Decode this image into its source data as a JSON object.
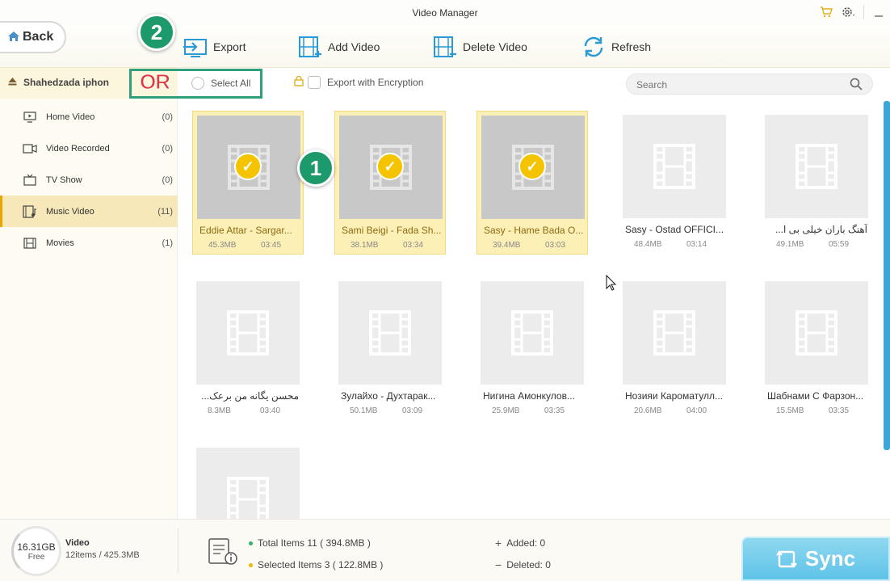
{
  "window": {
    "title": "Video Manager"
  },
  "toolbar": {
    "back_label": "Back",
    "export_label": "Export",
    "add_label": "Add Video",
    "delete_label": "Delete Video",
    "refresh_label": "Refresh"
  },
  "annotations": {
    "step1": "1",
    "step2": "2",
    "or": "OR"
  },
  "device": {
    "name": "Shahedzada iphon"
  },
  "selection": {
    "select_all_label": "Select All",
    "encryption_label": "Export with Encryption"
  },
  "search": {
    "placeholder": "Search"
  },
  "sidebar": {
    "items": [
      {
        "label": "Home Video",
        "count": "(0)",
        "icon": "home-video-icon"
      },
      {
        "label": "Video Recorded",
        "count": "(0)",
        "icon": "camera-icon"
      },
      {
        "label": "TV Show",
        "count": "(0)",
        "icon": "tv-icon"
      },
      {
        "label": "Music Video",
        "count": "(11)",
        "icon": "music-video-icon",
        "active": true
      },
      {
        "label": "Movies",
        "count": "(1)",
        "icon": "film-icon"
      }
    ]
  },
  "videos": [
    {
      "name": "Eddie Attar - Sargar...",
      "size": "45.3MB",
      "duration": "03:45",
      "selected": true
    },
    {
      "name": "Sami Beigi - Fada Sh...",
      "size": "38.1MB",
      "duration": "03:34",
      "selected": true
    },
    {
      "name": "Sasy - Hame Bada O...",
      "size": "39.4MB",
      "duration": "03:03",
      "selected": true
    },
    {
      "name": "Sasy - Ostad OFFICI...",
      "size": "48.4MB",
      "duration": "03:14",
      "selected": false
    },
    {
      "name": "آهنگ باران خیلی بی ا...",
      "size": "49.1MB",
      "duration": "05:59",
      "selected": false
    },
    {
      "name": "محسن یگانه من برعک...",
      "size": "8.3MB",
      "duration": "03:40",
      "selected": false
    },
    {
      "name": "Зулайхо - Духтарак...",
      "size": "50.1MB",
      "duration": "03:09",
      "selected": false
    },
    {
      "name": "Нигина Амонкулов...",
      "size": "25.9MB",
      "duration": "03:35",
      "selected": false
    },
    {
      "name": "Нозияи Кароматулл...",
      "size": "20.6MB",
      "duration": "04:00",
      "selected": false
    },
    {
      "name": "Шабнами С Фарзон...",
      "size": "15.5MB",
      "duration": "03:35",
      "selected": false
    },
    {
      "name": "",
      "size": "",
      "duration": "",
      "selected": false
    }
  ],
  "footer": {
    "storage_free": "16.31GB",
    "free_label": "Free",
    "category": "Video",
    "category_summary": "12items / 425.3MB",
    "total_items": "Total Items 11 ( 394.8MB )",
    "selected_items": "Selected Items 3 ( 122.8MB )",
    "added": "Added: 0",
    "deleted": "Deleted: 0",
    "sync_label": "Sync"
  },
  "colors": {
    "accent": "#e8a600",
    "badge": "#1d9a6c",
    "sync": "#5ec3e8",
    "selected_bg": "#fdf0b7"
  }
}
